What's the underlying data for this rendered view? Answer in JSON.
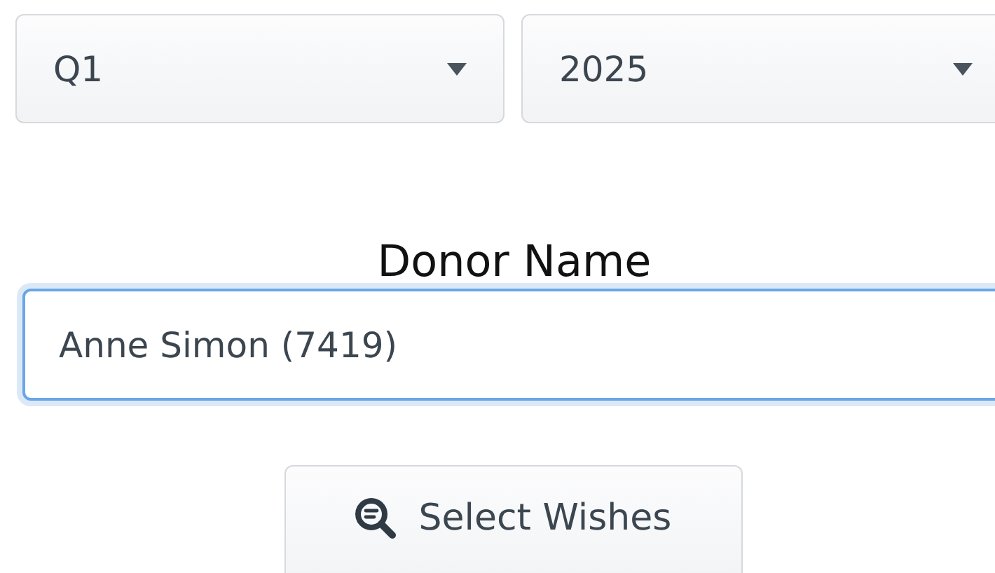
{
  "selects": [
    {
      "value": "Q1"
    },
    {
      "value": "2025"
    }
  ],
  "donor": {
    "label": "Donor Name",
    "value": "Anne Simon (7419)",
    "focused": true
  },
  "button": {
    "label": "Select Wishes"
  }
}
